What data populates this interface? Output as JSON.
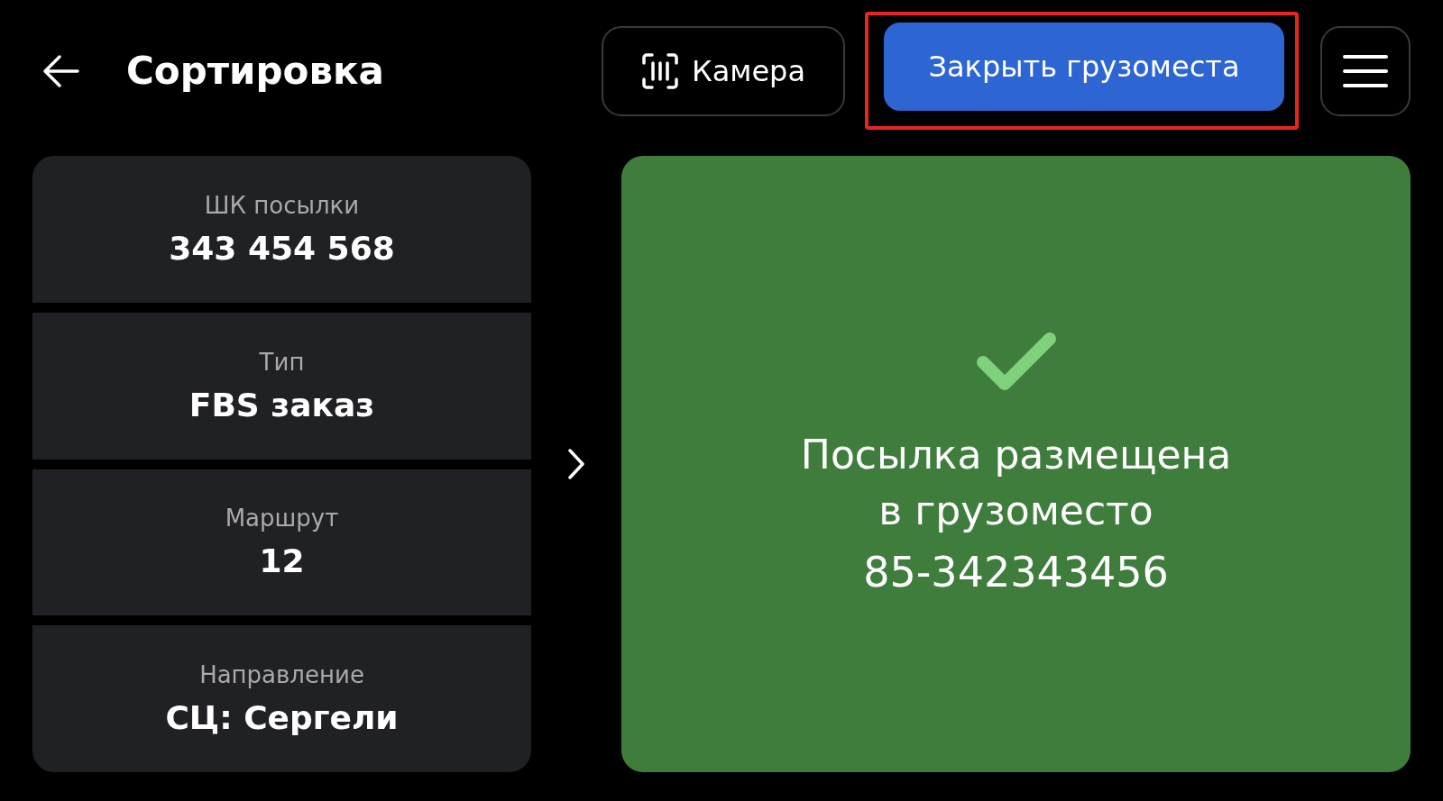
{
  "header": {
    "title": "Сортировка",
    "camera_button": "Камера",
    "close_button": {
      "label": "Закрыть грузоместа",
      "highlighted": true
    }
  },
  "details": [
    {
      "label": "ШК посылки",
      "value": "343 454 568"
    },
    {
      "label": "Тип",
      "value": "FBS заказ"
    },
    {
      "label": "Маршрут",
      "value": "12"
    },
    {
      "label": "Направление",
      "value": "СЦ: Сергели"
    }
  ],
  "result": {
    "success": true,
    "message_lines": [
      "Посылка размещена",
      "в грузоместо"
    ],
    "code": "85-342343456"
  }
}
